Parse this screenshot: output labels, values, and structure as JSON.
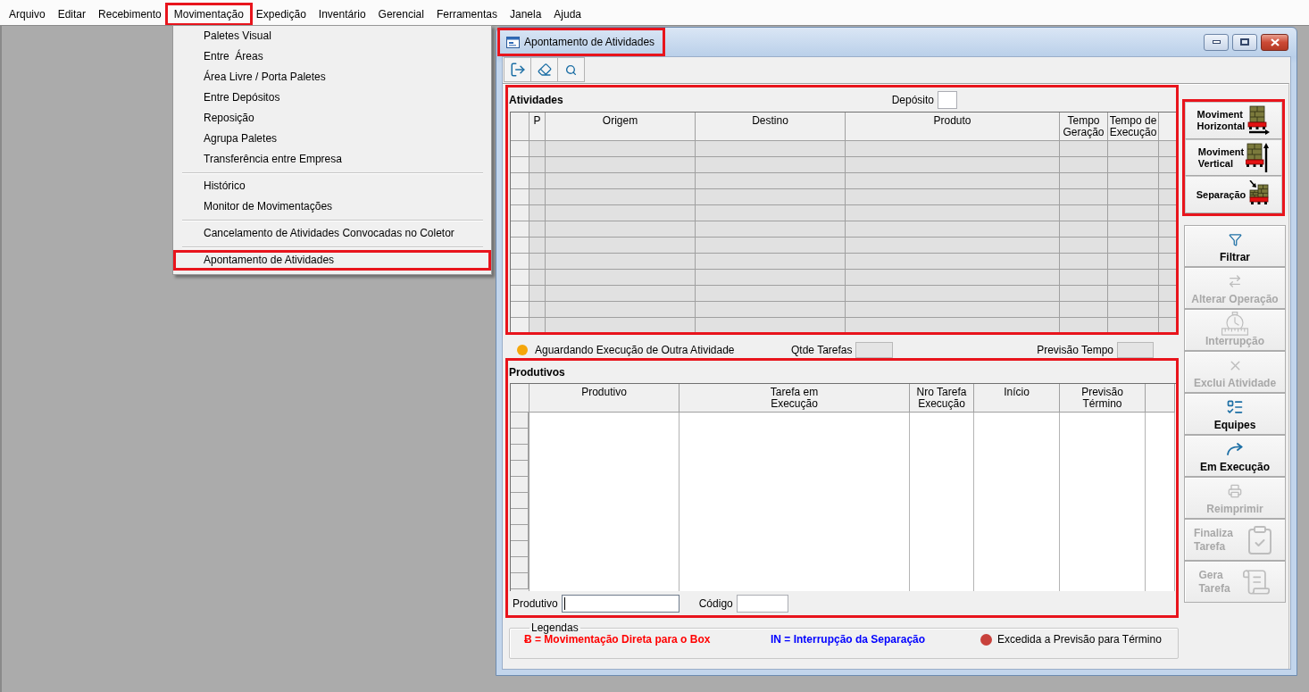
{
  "menu_bar": {
    "items": [
      {
        "label": "Arquivo",
        "highlight": false
      },
      {
        "label": "Editar",
        "highlight": false
      },
      {
        "label": "Recebimento",
        "highlight": false
      },
      {
        "label": "Movimentação",
        "highlight": true
      },
      {
        "label": "Expedição",
        "highlight": false
      },
      {
        "label": "Inventário",
        "highlight": false
      },
      {
        "label": "Gerencial",
        "highlight": false
      },
      {
        "label": "Ferramentas",
        "highlight": false
      },
      {
        "label": "Janela",
        "highlight": false
      },
      {
        "label": "Ajuda",
        "highlight": false
      }
    ]
  },
  "dropdown_menu": {
    "sections": [
      {
        "items": [
          {
            "label": "Paletes Visual",
            "highlight": false
          },
          {
            "label": "Entre  Áreas",
            "highlight": false
          },
          {
            "label": "Área Livre / Porta Paletes",
            "highlight": false
          },
          {
            "label": "Entre Depósitos",
            "highlight": false
          },
          {
            "label": "Reposição",
            "highlight": false
          },
          {
            "label": "Agrupa Paletes",
            "highlight": false
          },
          {
            "label": "Transferência entre Empresa",
            "highlight": false
          }
        ]
      },
      {
        "items": [
          {
            "label": "Histórico",
            "highlight": false
          },
          {
            "label": "Monitor de Movimentações",
            "highlight": false
          }
        ]
      },
      {
        "items": [
          {
            "label": "Cancelamento de Atividades Convocadas no Coletor",
            "highlight": false
          }
        ]
      },
      {
        "items": [
          {
            "label": "Apontamento de Atividades",
            "highlight": true
          }
        ]
      }
    ]
  },
  "window": {
    "title": "Apontamento de Atividades",
    "title_highlight": true
  },
  "activities": {
    "title": "Atividades",
    "highlight": true,
    "deposit_label": "Depósito",
    "columns": [
      "P",
      "Origem",
      "Destino",
      "Produto",
      "Tempo\nGeração",
      "Tempo de\nExecução"
    ]
  },
  "status": {
    "waiting_label": "Aguardando Execução de Outra Atividade",
    "task_count_label": "Qtde Tarefas",
    "time_forecast_label": "Previsão Tempo"
  },
  "workers": {
    "title": "Produtivos",
    "highlight": true,
    "columns": [
      "Produtivo",
      "Tarefa em\nExecução",
      "Nro Tarefa\nExecução",
      "Início",
      "Previsão\nTérmino"
    ],
    "filters": [
      {
        "label": "Produtivo",
        "focused": true
      },
      {
        "label": "Código",
        "focused": false
      }
    ]
  },
  "legend": {
    "title": "Legendas",
    "items": [
      {
        "kind": "text",
        "label": "Ƀ = Movimentação Direta para o Box",
        "color": "#ff0000"
      },
      {
        "kind": "text",
        "label": "IN = Interrupção da Separação",
        "color": "#0000ff"
      },
      {
        "kind": "dot",
        "label": "Excedida a Previsão para Término",
        "color": "#c8413b"
      }
    ]
  },
  "movement_buttons": {
    "highlight": true,
    "items": [
      {
        "label": "Moviment\nHorizontal"
      },
      {
        "label": "Moviment\nVertical"
      },
      {
        "label": "Separação"
      }
    ]
  },
  "action_buttons": [
    {
      "label": "Filtrar",
      "disabled": false,
      "kind": "stacked"
    },
    {
      "label": "Alterar Operação",
      "disabled": true,
      "kind": "stacked"
    },
    {
      "label": "Interrupção",
      "disabled": true,
      "kind": "stacked"
    },
    {
      "label": "Exclui Atividade",
      "disabled": true,
      "kind": "stacked"
    },
    {
      "label": "Equipes",
      "disabled": false,
      "kind": "stacked"
    },
    {
      "label": "Em Execução",
      "disabled": false,
      "kind": "stacked"
    },
    {
      "label": "Reimprimir",
      "disabled": true,
      "kind": "stacked"
    },
    {
      "label": "Finaliza\nTarefa",
      "disabled": true,
      "kind": "side"
    },
    {
      "label": "Gera\nTarefa",
      "disabled": true,
      "kind": "side"
    }
  ]
}
